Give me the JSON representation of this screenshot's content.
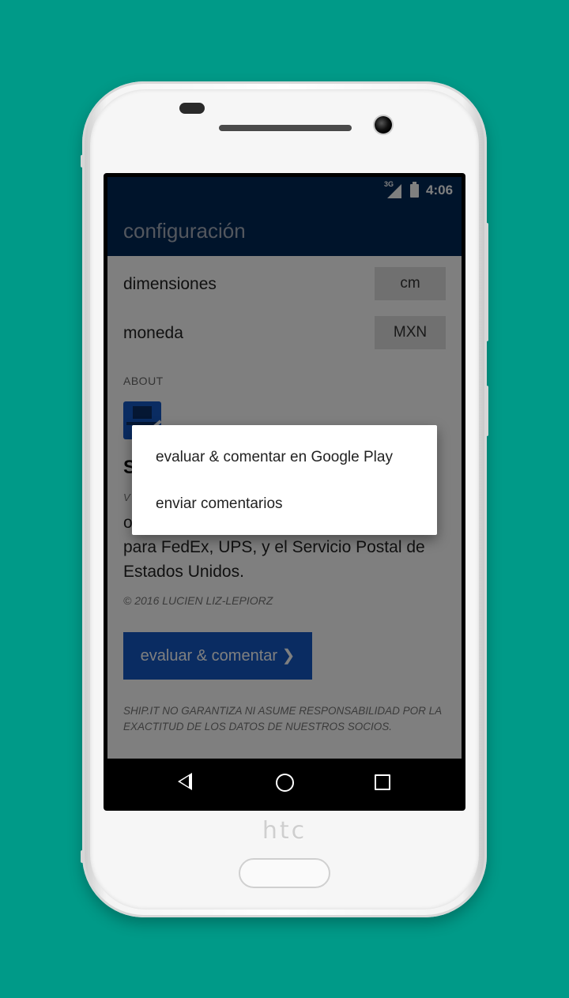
{
  "statusbar": {
    "network": "3G",
    "time": "4:06"
  },
  "appbar": {
    "title": "configuración"
  },
  "settings": {
    "dimensions_label": "dimensiones",
    "dimensions_value": "cm",
    "currency_label": "moneda",
    "currency_value": "MXN"
  },
  "about": {
    "section_label": "ABOUT",
    "app_name_partial": "S",
    "version_partial": "V",
    "description_partial_line1": "o",
    "description_line2": "para FedEx, UPS, y el Servicio Postal de",
    "description_line3": "Estados Unidos.",
    "copyright": "© 2016 LUCIEN LIZ-LEPIORZ",
    "rate_button": "evaluar & comentar ❯",
    "disclaimer": "SHIP.IT NO GARANTIZA NI ASUME RESPONSABILIDAD POR LA EXACTITUD DE LOS DATOS DE NUESTROS SOCIOS."
  },
  "dialog": {
    "items": [
      {
        "label": "evaluar & comentar en Google Play"
      },
      {
        "label": "enviar comentarios"
      }
    ]
  },
  "device": {
    "brand": "htc"
  },
  "colors": {
    "background": "#009a88",
    "primary_dark": "#002856",
    "accent": "#1459c4"
  }
}
